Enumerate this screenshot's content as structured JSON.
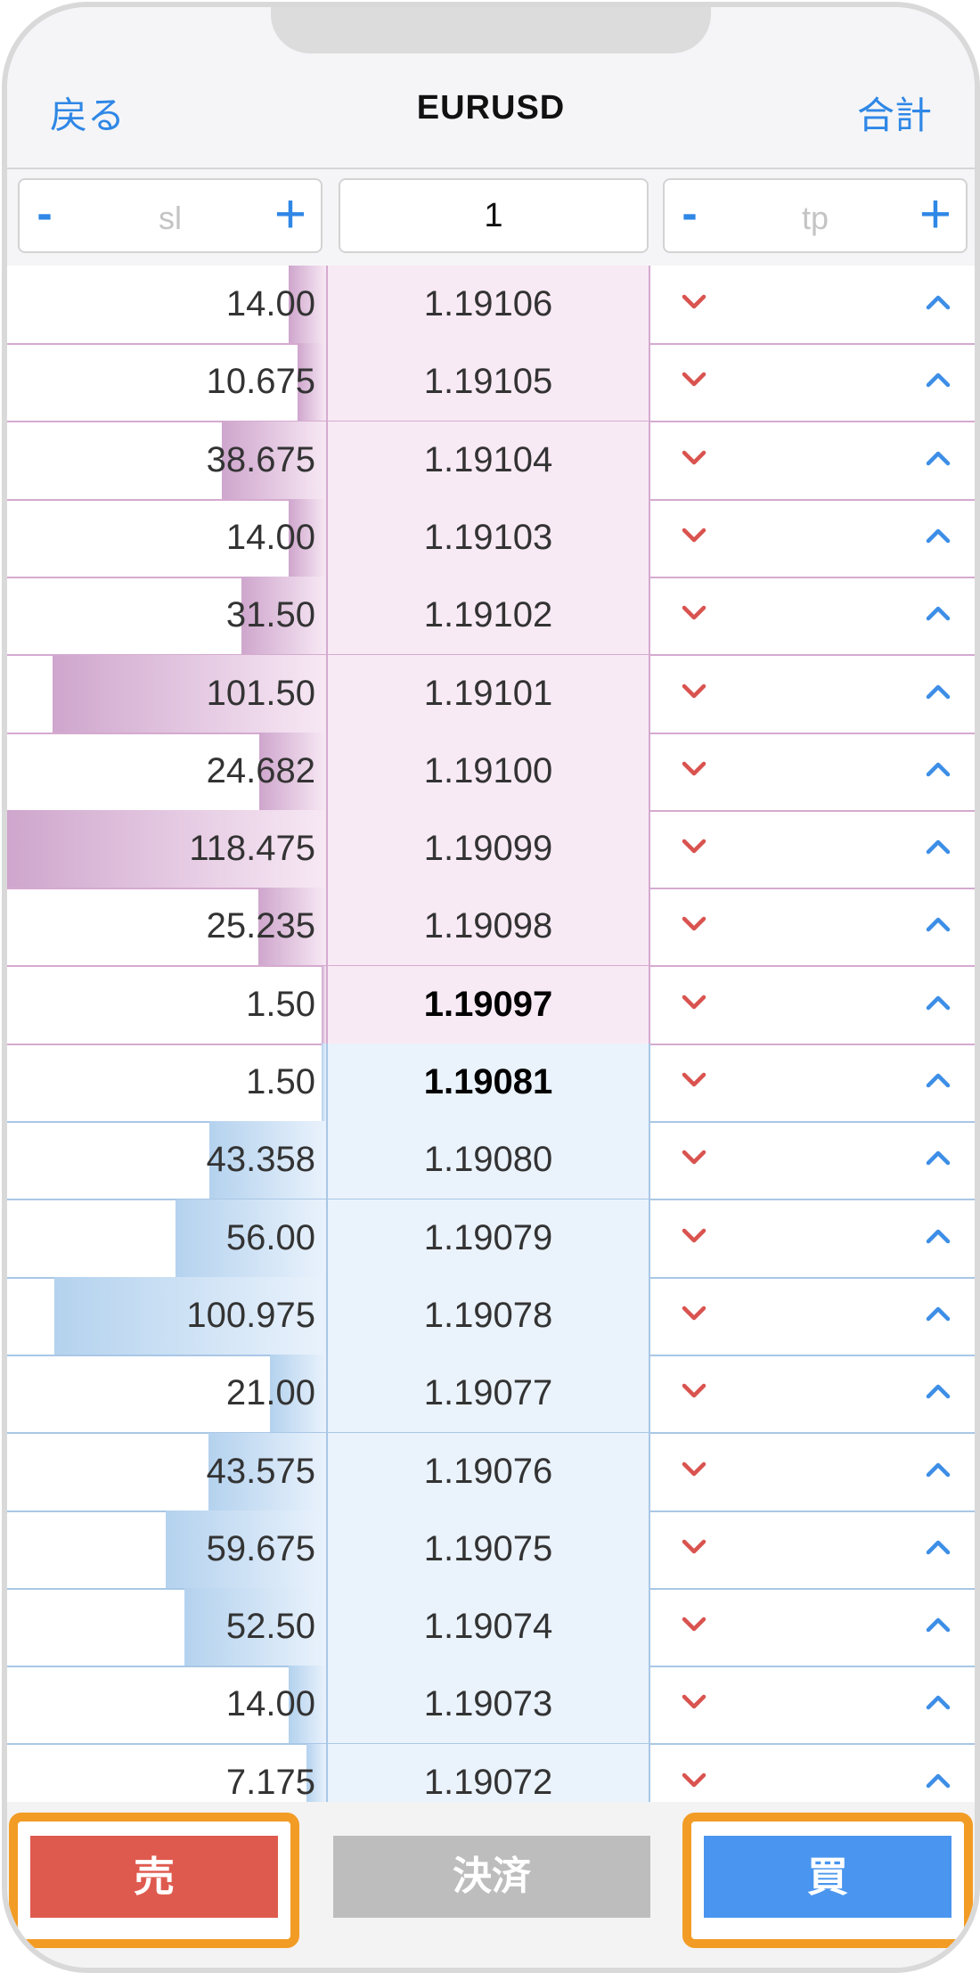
{
  "navbar": {
    "back_label": "戻る",
    "title": "EURUSD",
    "total_label": "合計"
  },
  "controls": {
    "sl": {
      "minus": "-",
      "placeholder": "sl",
      "plus": "+"
    },
    "volume": "1",
    "tp": {
      "minus": "-",
      "placeholder": "tp",
      "plus": "+"
    }
  },
  "ladder": {
    "max_volume": 118.475,
    "rows": [
      {
        "side": "ask",
        "volume": "14.00",
        "price": "1.19106",
        "best": false
      },
      {
        "side": "ask",
        "volume": "10.675",
        "price": "1.19105",
        "best": false
      },
      {
        "side": "ask",
        "volume": "38.675",
        "price": "1.19104",
        "best": false
      },
      {
        "side": "ask",
        "volume": "14.00",
        "price": "1.19103",
        "best": false
      },
      {
        "side": "ask",
        "volume": "31.50",
        "price": "1.19102",
        "best": false
      },
      {
        "side": "ask",
        "volume": "101.50",
        "price": "1.19101",
        "best": false
      },
      {
        "side": "ask",
        "volume": "24.682",
        "price": "1.19100",
        "best": false
      },
      {
        "side": "ask",
        "volume": "118.475",
        "price": "1.19099",
        "best": false
      },
      {
        "side": "ask",
        "volume": "25.235",
        "price": "1.19098",
        "best": false
      },
      {
        "side": "ask",
        "volume": "1.50",
        "price": "1.19097",
        "best": true
      },
      {
        "side": "bid",
        "volume": "1.50",
        "price": "1.19081",
        "best": true
      },
      {
        "side": "bid",
        "volume": "43.358",
        "price": "1.19080",
        "best": false
      },
      {
        "side": "bid",
        "volume": "56.00",
        "price": "1.19079",
        "best": false
      },
      {
        "side": "bid",
        "volume": "100.975",
        "price": "1.19078",
        "best": false
      },
      {
        "side": "bid",
        "volume": "21.00",
        "price": "1.19077",
        "best": false
      },
      {
        "side": "bid",
        "volume": "43.575",
        "price": "1.19076",
        "best": false
      },
      {
        "side": "bid",
        "volume": "59.675",
        "price": "1.19075",
        "best": false
      },
      {
        "side": "bid",
        "volume": "52.50",
        "price": "1.19074",
        "best": false
      },
      {
        "side": "bid",
        "volume": "14.00",
        "price": "1.19073",
        "best": false
      },
      {
        "side": "bid",
        "volume": "7.175",
        "price": "1.19072",
        "best": false
      }
    ]
  },
  "icons": {
    "sell_arrow": "chevron-down-icon",
    "buy_arrow": "chevron-up-icon"
  },
  "colors": {
    "accent": "#2f87e6",
    "ask_bar": "#cfa6cd",
    "bid_bar": "#b4d2ee",
    "sell_arrow": "#d9534f",
    "buy_arrow": "#3d8ee6",
    "sell_button": "#df5a4e",
    "buy_button": "#4a95ef",
    "close_button": "#bdbdbd",
    "highlight": "#f29c25"
  },
  "bottombar": {
    "sell_label": "売",
    "close_label": "決済",
    "buy_label": "買"
  }
}
